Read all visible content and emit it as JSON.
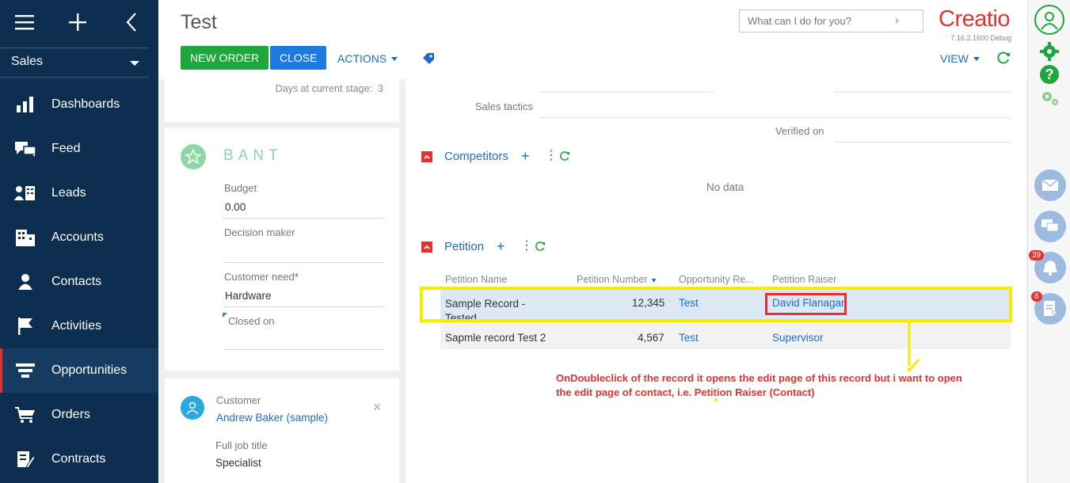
{
  "sidebar": {
    "workplace": "Sales",
    "items": [
      {
        "label": "Dashboards",
        "icon": "dashboards-icon"
      },
      {
        "label": "Feed",
        "icon": "feed-icon"
      },
      {
        "label": "Leads",
        "icon": "leads-icon"
      },
      {
        "label": "Accounts",
        "icon": "accounts-icon"
      },
      {
        "label": "Contacts",
        "icon": "contacts-icon"
      },
      {
        "label": "Activities",
        "icon": "activities-icon"
      },
      {
        "label": "Opportunities",
        "icon": "opportunities-icon"
      },
      {
        "label": "Orders",
        "icon": "orders-icon"
      },
      {
        "label": "Contracts",
        "icon": "contracts-icon"
      }
    ]
  },
  "header": {
    "title": "Test",
    "new_order": "NEW ORDER",
    "close": "CLOSE",
    "actions": "ACTIONS",
    "view": "VIEW",
    "search_placeholder": "What can I do for you?",
    "logo": "Creatio",
    "version": "7.16.2.1600 Debug"
  },
  "left": {
    "days_at_stage_label": "Days at current stage:",
    "days_at_stage_value": "3",
    "bant_title": "BANT",
    "budget_label": "Budget",
    "budget_value": "0.00",
    "decision_maker_label": "Decision maker",
    "customer_need_label": "Customer need",
    "required_mark": "*",
    "customer_need_value": "Hardware",
    "closed_on_label": "Closed on",
    "customer_label": "Customer",
    "customer_value": "Andrew Baker (sample)",
    "job_title_label": "Full job title",
    "job_title_value": "Specialist"
  },
  "main": {
    "sales_tactics_label": "Sales tactics",
    "verified_on_label": "Verified on",
    "competitors_title": "Competitors",
    "no_data": "No data",
    "petition_title": "Petition",
    "columns": [
      "Petition Name",
      "Petition Number",
      "Opportunity Re...",
      "Petition Raiser"
    ],
    "rows": [
      {
        "name": "Sample Record - Tested",
        "number": "12,345",
        "opportunity": "Test",
        "raiser": "David Flanagan"
      },
      {
        "name": "Sapmle record Test 2",
        "number": "4,567",
        "opportunity": "Test",
        "raiser": "Supervisor"
      }
    ],
    "annotation": "OnDoubleclick of the record it opens the edit page of this record but i want to open the edit page of contact, i.e. Petition Raiser (Contact)"
  },
  "rightbar": {
    "notifications_count": "39",
    "tasks_count": "8"
  },
  "colors": {
    "sidebar_bg": "#0d2e4e",
    "accent_red": "#e5322f",
    "accent_green": "#1fa63d",
    "accent_blue": "#1f7ae0",
    "highlight_yellow": "#f5ec00"
  }
}
